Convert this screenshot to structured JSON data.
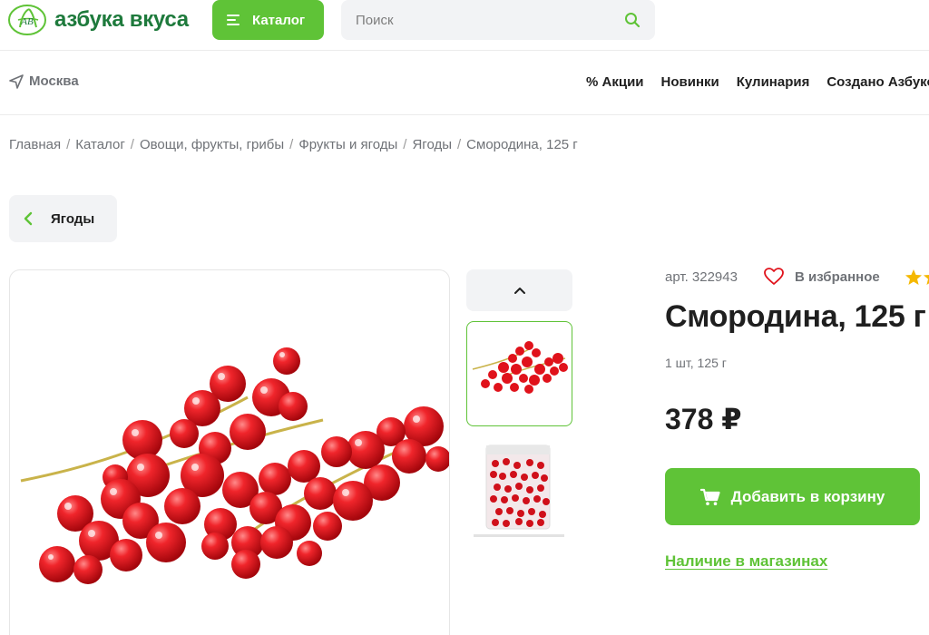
{
  "header": {
    "logo_text": "азбука вкуса",
    "logo_monogram": "АВ",
    "catalog_label": "Каталог",
    "search_placeholder": "Поиск"
  },
  "subheader": {
    "city": "Москва",
    "nav": [
      "% Акции",
      "Новинки",
      "Кулинария",
      "Создано Азбукой"
    ]
  },
  "breadcrumb": [
    "Главная",
    "Каталог",
    "Овощи, фрукты, грибы",
    "Фрукты и ягоды",
    "Ягоды",
    "Смородина, 125 г"
  ],
  "back_button": {
    "label": "Ягоды"
  },
  "product": {
    "article": "арт. 322943",
    "favorite_label": "В избранное",
    "title": "Смородина, 125 г",
    "unit": "1 шт, 125 г",
    "price": "378 ₽",
    "add_to_cart_label": "Добавить в корзину",
    "availability_label": "Наличие в магазинах"
  },
  "colors": {
    "brand_green": "#5fc337",
    "logo_green": "#1e7a3c",
    "berry_red": "#e0121b",
    "star_yellow": "#f5b800"
  },
  "icons": {
    "menu": "burger-icon",
    "search": "search-icon",
    "location": "location-arrow-icon",
    "back": "chevron-left-icon",
    "thumb_up": "chevron-up-icon",
    "favorite": "heart-icon",
    "rating": "star-icon",
    "cart": "cart-icon"
  }
}
